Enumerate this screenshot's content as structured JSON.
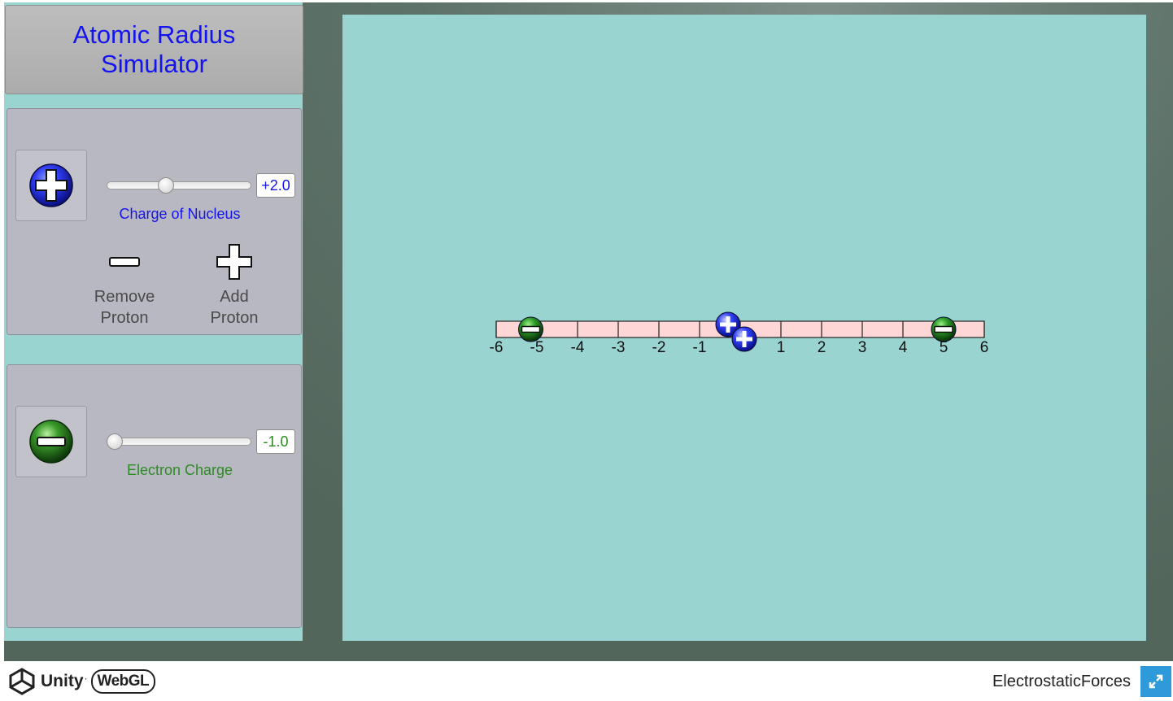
{
  "title": "Atomic Radius Simulator",
  "proton_panel": {
    "icon": "proton-plus-icon",
    "slider_value": "+2.0",
    "slider_fraction": 0.4,
    "slider_label": "Charge of Nucleus",
    "label_color": "#1414f0",
    "remove_button": {
      "icon": "minus-icon",
      "label_line1": "Remove",
      "label_line2": "Proton"
    },
    "add_button": {
      "icon": "plus-icon",
      "label_line1": "Add",
      "label_line2": "Proton"
    }
  },
  "electron_panel": {
    "icon": "electron-minus-icon",
    "slider_value": "-1.0",
    "slider_fraction": 0.0,
    "slider_label": "Electron Charge",
    "label_color": "#2e8b24"
  },
  "number_line": {
    "min": -6,
    "max": 6,
    "tick_labels": [
      "-6",
      "-5",
      "-4",
      "-3",
      "-2",
      "-1",
      "1",
      "2",
      "3",
      "4",
      "5",
      "6"
    ],
    "protons_at": [
      -0.3,
      0.1
    ],
    "electrons_at": [
      -5.15,
      5.0
    ],
    "bar_color": "#ffd6d6"
  },
  "footer": {
    "engine_label": "Unity",
    "webgl_label": "WebGL",
    "build_title": "ElectrostaticForces",
    "fullscreen_icon": "fullscreen-expand-icon"
  }
}
